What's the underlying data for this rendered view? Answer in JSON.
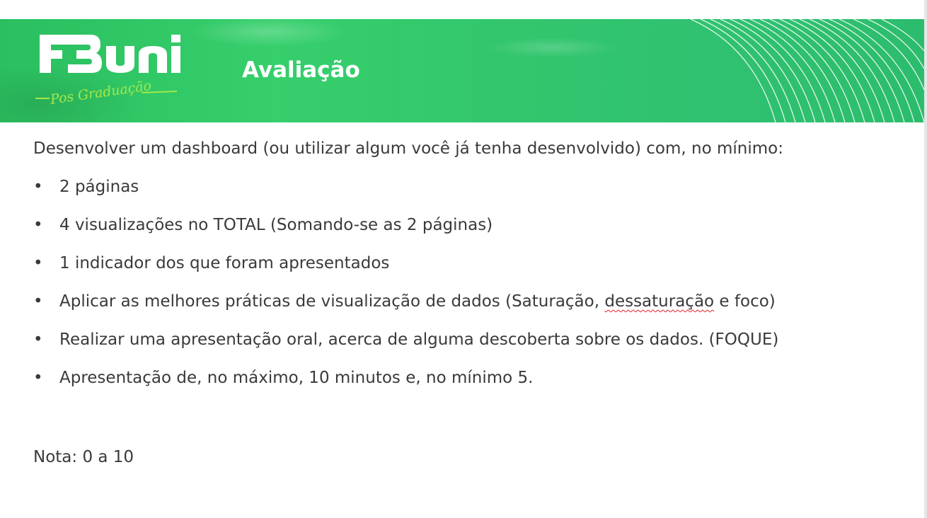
{
  "slide": {
    "title": "Avaliação",
    "logo": {
      "brand": "FBuni",
      "tagline": "Pos Graduação"
    },
    "intro": "Desenvolver um dashboard (ou utilizar algum você já tenha desenvolvido) com, no mínimo:",
    "bullet_marker": "•",
    "bullets": [
      {
        "text": "2 páginas"
      },
      {
        "text": "4 visualizações no TOTAL (Somando-se as 2 páginas)"
      },
      {
        "text": "1 indicador dos que foram apresentados"
      },
      {
        "before": "Aplicar as melhores práticas de visualização de dados (Saturação, ",
        "flagged": "dessaturação",
        "after": " e foco)"
      },
      {
        "text": "Realizar uma apresentação oral, acerca de alguma descoberta sobre os dados. (FOQUE)"
      },
      {
        "text": "Apresentação de, no máximo, 10 minutos e, no mínimo 5."
      }
    ],
    "note": "Nota: 0 a 10"
  },
  "colors": {
    "banner_green": "#33c66d",
    "logo_accent": "#a4e84a",
    "text": "#3a3a3a",
    "spellcheck_underline": "#e0232b"
  },
  "icons": [
    "fbuni-logo",
    "decorative-arcs",
    "bullet-dot"
  ]
}
